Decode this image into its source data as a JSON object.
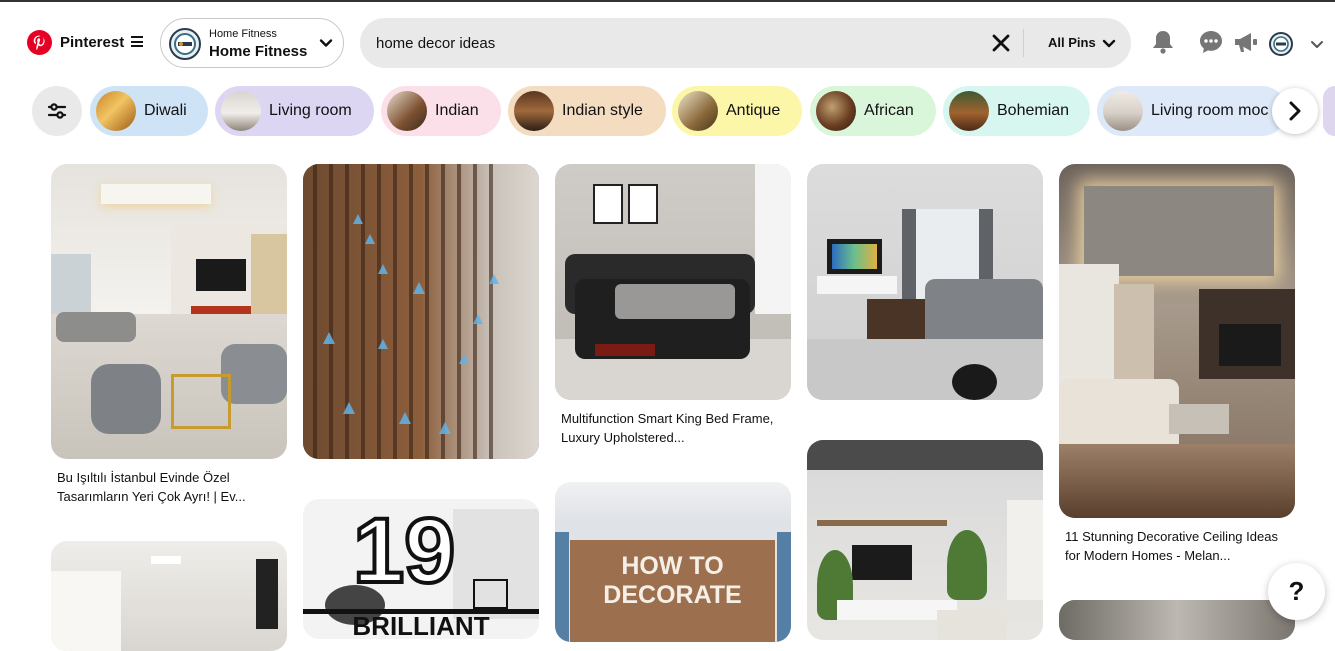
{
  "header": {
    "brand": "Pinterest",
    "board_switcher": {
      "label": "Home Fitness",
      "name": "Home Fitness"
    },
    "search": {
      "value": "home decor ideas",
      "scope": "All Pins"
    },
    "icons": [
      "pinterest-logo-icon",
      "menu-icon",
      "chevron-down-icon",
      "clear-icon",
      "bell-icon",
      "chat-icon",
      "megaphone-icon",
      "avatar",
      "chevron-down-icon"
    ]
  },
  "chips": [
    {
      "label": "Diwali",
      "color": "#cfe3f7"
    },
    {
      "label": "Living room",
      "color": "#dcd6f3"
    },
    {
      "label": "Indian",
      "color": "#fbe0ea"
    },
    {
      "label": "Indian style",
      "color": "#f3dcc0"
    },
    {
      "label": "Antique",
      "color": "#fbf6a8"
    },
    {
      "label": "African",
      "color": "#d9f5da"
    },
    {
      "label": "Bohemian",
      "color": "#d6f6ef"
    },
    {
      "label": "Living room moc",
      "color": "#dde9f8"
    }
  ],
  "pins": {
    "col1_top_caption": "Bu Işıltılı İstanbul Evinde Özel Tasarımların Yeri Çok Ayrı! | Ev...",
    "col3_top_caption": "Multifunction Smart King Bed Frame, Luxury Upholstered...",
    "col5_top_caption": "11 Stunning Decorative Ceiling Ideas for Modern Homes - Melan...",
    "col2_second_text": [
      "19",
      "BRILLIANT"
    ],
    "col3_second_text": [
      "HOW TO",
      "DECORATE"
    ]
  },
  "help": {
    "label": "?"
  }
}
